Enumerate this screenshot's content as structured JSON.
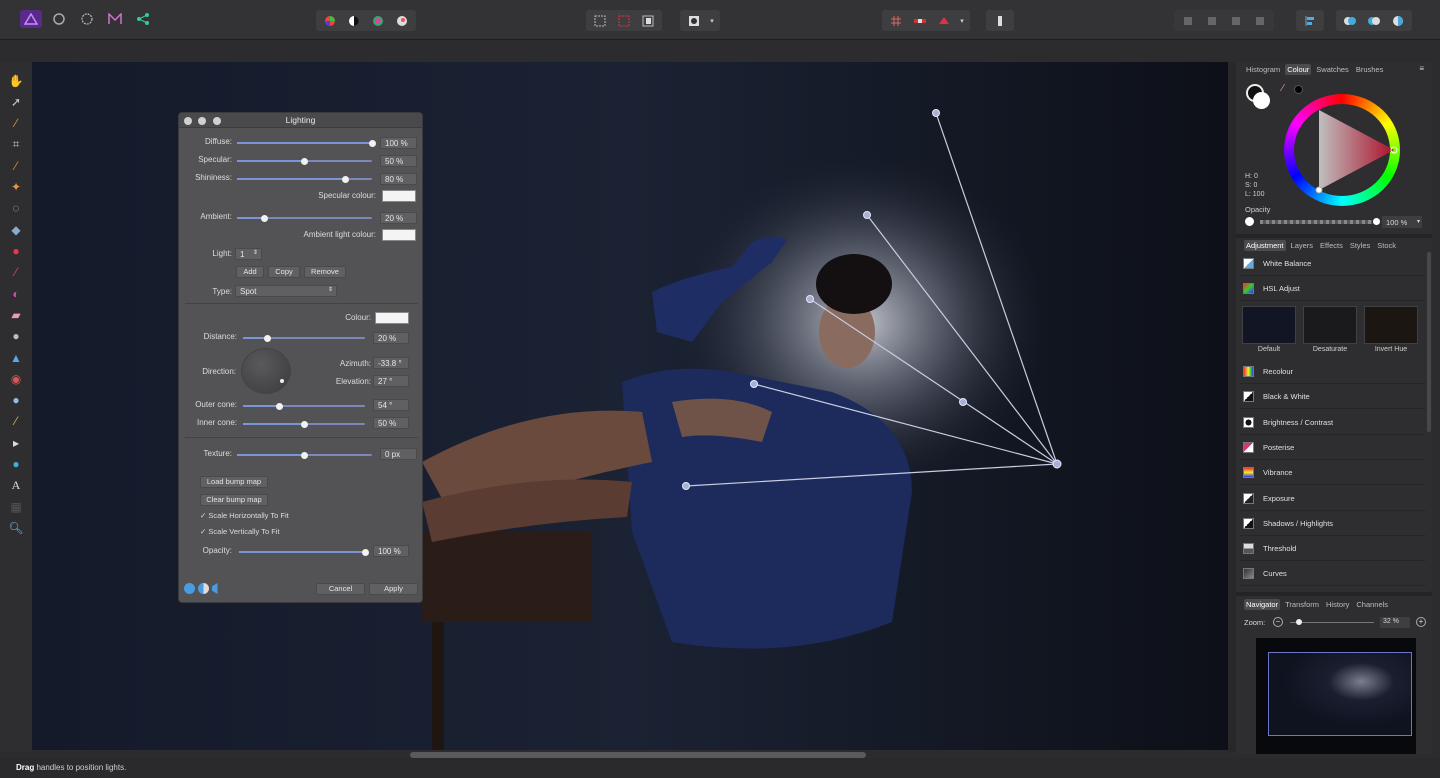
{
  "toolbar": {
    "persona_icons": [
      "photo-persona-icon",
      "liquify-persona-icon",
      "develop-persona-icon",
      "tone-mapping-persona-icon",
      "export-persona-icon"
    ],
    "color_icons": [
      "auto-levels-icon",
      "auto-contrast-icon",
      "auto-colours-icon",
      "auto-white-balance-icon"
    ],
    "selection_icons": [
      "marquee-icon",
      "rect-selection-icon",
      "invert-selection-icon"
    ],
    "mask_icons": [
      "quick-mask-icon",
      "quick-mask-dropdown-icon"
    ],
    "snapping_icons": [
      "snapping-grid-icon",
      "snapping-toggle-icon",
      "snapping-settings-icon"
    ],
    "assistant_icon": "assistant-icon",
    "arrange_icons": [
      "forward-icon",
      "back-icon",
      "front-icon",
      "bottom-icon"
    ],
    "align_icon": "align-icon",
    "boolean_icons": [
      "add-icon",
      "subtract-icon",
      "intersect-icon"
    ]
  },
  "tools": [
    "view-tool",
    "move-tool",
    "color-picker-tool",
    "crop-tool",
    "paint-brush-tool",
    "flood-select-tool",
    "marquee-tool",
    "fill-tool",
    "gradient-tool",
    "painting-brush-tool",
    "selection-brush-tool",
    "erase-tool",
    "dodge-tool",
    "clone-tool",
    "red-eye-tool",
    "smudge-tool",
    "blur-tool",
    "node-tool",
    "shape-tool",
    "text-tool",
    "mesh-tool",
    "zoom-tool"
  ],
  "dialog": {
    "title": "Lighting",
    "diffuse": {
      "label": "Diffuse:",
      "value": "100 %",
      "fraction": 1.0
    },
    "specular": {
      "label": "Specular:",
      "value": "50 %",
      "fraction": 0.5
    },
    "shininess": {
      "label": "Shininess:",
      "value": "80 %",
      "fraction": 0.8
    },
    "specular_colour_label": "Specular colour:",
    "ambient": {
      "label": "Ambient:",
      "value": "20 %",
      "fraction": 0.2
    },
    "ambient_light_colour_label": "Ambient light colour:",
    "light": {
      "label": "Light:",
      "value": "1"
    },
    "add_label": "Add",
    "copy_label": "Copy",
    "remove_label": "Remove",
    "type": {
      "label": "Type:",
      "value": "Spot"
    },
    "colour_label": "Colour:",
    "distance": {
      "label": "Distance:",
      "value": "20 %",
      "fraction": 0.2
    },
    "direction_label": "Direction:",
    "azimuth": {
      "label": "Azimuth:",
      "value": "-33.8 °"
    },
    "elevation": {
      "label": "Elevation:",
      "value": "27 °"
    },
    "outer_cone": {
      "label": "Outer cone:",
      "value": "54 °",
      "fraction": 0.3
    },
    "inner_cone": {
      "label": "Inner cone:",
      "value": "50 %",
      "fraction": 0.5
    },
    "texture": {
      "label": "Texture:",
      "value": "0 px",
      "fraction": 0.5
    },
    "load_bump_label": "Load bump map",
    "clear_bump_label": "Clear bump map",
    "scale_h_label": "Scale Horizontally To Fit",
    "scale_v_label": "Scale Vertically To Fit",
    "opacity": {
      "label": "Opacity:",
      "value": "100 %",
      "fraction": 1.0
    },
    "cancel_label": "Cancel",
    "apply_label": "Apply"
  },
  "colour_panel": {
    "tabs": [
      "Histogram",
      "Colour",
      "Swatches",
      "Brushes"
    ],
    "active_tab": "Colour",
    "h": "H: 0",
    "s": "S: 0",
    "l": "L: 100",
    "opacity_label": "Opacity",
    "opacity_value": "100 %",
    "accent": "#e8163a"
  },
  "adjustment_panel": {
    "tabs": [
      "Adjustment",
      "Layers",
      "Effects",
      "Styles",
      "Stock"
    ],
    "active_tab": "Adjustment",
    "items_top": [
      "White Balance",
      "HSL Adjust"
    ],
    "presets": [
      "Default",
      "Desaturate",
      "Invert Hue"
    ],
    "items": [
      "Recolour",
      "Black & White",
      "Brightness / Contrast",
      "Posterise",
      "Vibrance",
      "Exposure",
      "Shadows / Highlights",
      "Threshold",
      "Curves"
    ]
  },
  "navigator_panel": {
    "tabs": [
      "Navigator",
      "Transform",
      "History",
      "Channels"
    ],
    "active_tab": "Navigator",
    "zoom_label": "Zoom:",
    "zoom_value": "32 %"
  },
  "status": {
    "bold": "Drag",
    "text": " handles to position lights."
  }
}
